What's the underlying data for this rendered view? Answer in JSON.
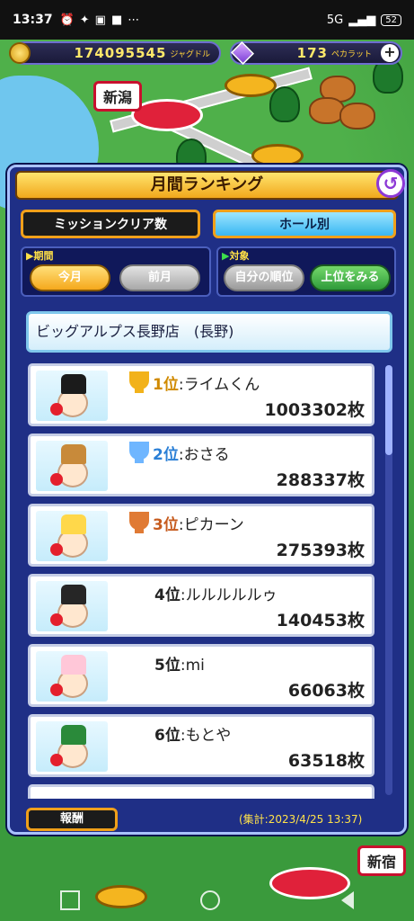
{
  "status_bar": {
    "time": "13:37",
    "network": "5G",
    "battery": "52"
  },
  "currency": {
    "coins": "174095545",
    "coins_unit": "ジャグドル",
    "gems": "173",
    "gems_unit": "ペカラット",
    "plus": "+"
  },
  "board": {
    "city_left": "新潟",
    "city_right": "新宿"
  },
  "panel": {
    "title": "月間ランキング",
    "back": "↺",
    "tab_mission": "ミッションクリア数",
    "tab_hall": "ホール別",
    "period_label": "期間",
    "period_current": "今月",
    "period_previous": "前月",
    "target_label": "対象",
    "target_mine": "自分の順位",
    "target_top": "上位をみる",
    "store": "ビッグアルプス長野店　(長野)",
    "reward_button": "報酬",
    "tally": "(集計:2023/4/25 13:37)"
  },
  "rankings": [
    {
      "rank": "1位",
      "name": ":ライムくん",
      "score": "1003302枚",
      "trophy": "gold"
    },
    {
      "rank": "2位",
      "name": ":おさる",
      "score": "288337枚",
      "trophy": "silver"
    },
    {
      "rank": "3位",
      "name": ":ピカーン",
      "score": "275393枚",
      "trophy": "bronze"
    },
    {
      "rank": "4位",
      "name": ":ルルルルルゥ",
      "score": "140453枚",
      "trophy": ""
    },
    {
      "rank": "5位",
      "name": ":mi",
      "score": "66063枚",
      "trophy": ""
    },
    {
      "rank": "6位",
      "name": ":もとや",
      "score": "63518枚",
      "trophy": ""
    }
  ],
  "colors": {
    "panel_bg": "#1f2f86",
    "gold": "#d08a00",
    "silver": "#2a7fd6",
    "bronze": "#c65b1e",
    "accent_orange": "#f0a01a"
  }
}
